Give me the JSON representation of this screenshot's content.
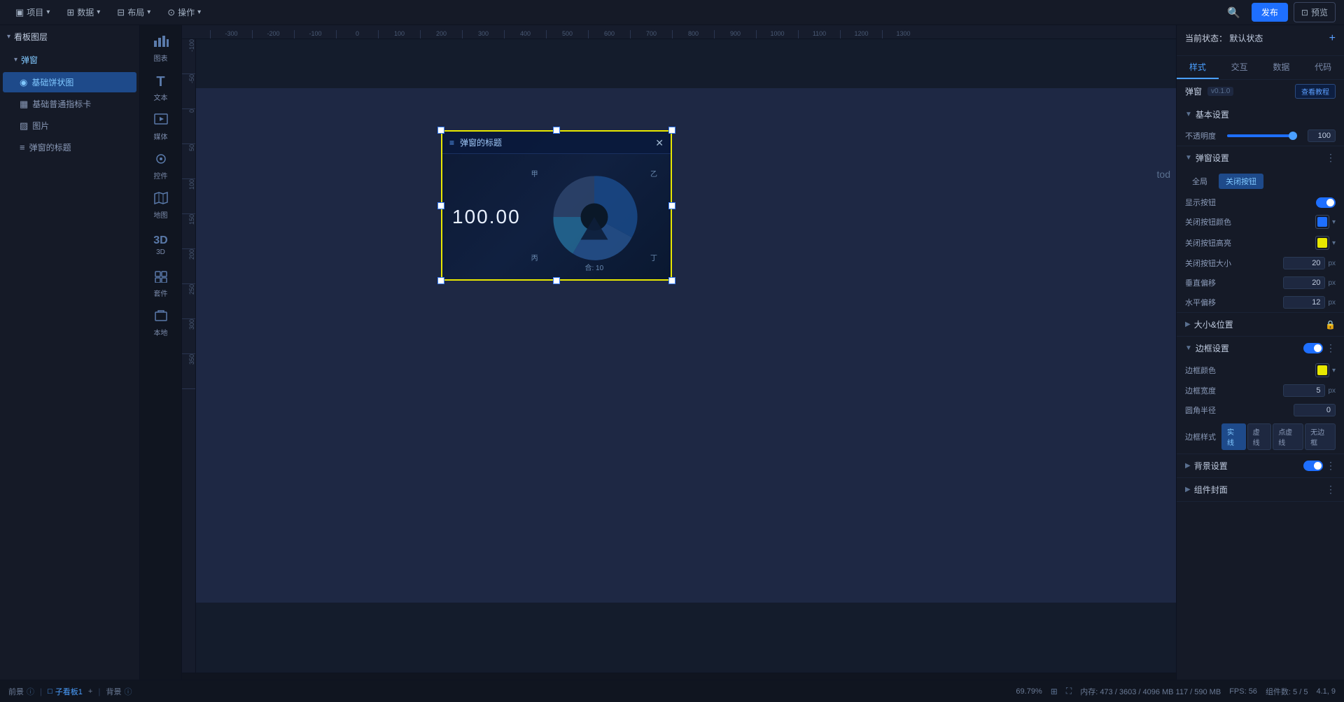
{
  "topbar": {
    "items": [
      {
        "id": "project",
        "icon": "▣",
        "label": "项目",
        "arrow": "▾"
      },
      {
        "id": "data",
        "icon": "⊞",
        "label": "数据",
        "arrow": "▾"
      },
      {
        "id": "layout",
        "icon": "⊟",
        "label": "布局",
        "arrow": "▾"
      },
      {
        "id": "actions",
        "icon": "⊙",
        "label": "操作",
        "arrow": "▾"
      }
    ],
    "publish_label": "发布",
    "preview_label": "预览"
  },
  "left_sidebar": {
    "section_label": "看板图层",
    "section_arrow": "▾",
    "subsection": {
      "label": "弹窗",
      "items": [
        {
          "id": "pie",
          "label": "基础饼状图",
          "icon": "◉"
        },
        {
          "id": "tabs",
          "label": "基础普通指标卡",
          "icon": "▦"
        },
        {
          "id": "image",
          "label": "图片",
          "icon": "▨"
        },
        {
          "id": "popuplabel",
          "label": "弹窗的标题",
          "icon": "≡"
        }
      ]
    }
  },
  "icon_panel": {
    "items": [
      {
        "id": "chart",
        "icon": "📊",
        "label": "图表"
      },
      {
        "id": "text",
        "icon": "T",
        "label": "文本"
      },
      {
        "id": "media",
        "icon": "▣",
        "label": "媒体"
      },
      {
        "id": "control",
        "icon": "⊡",
        "label": "控件"
      },
      {
        "id": "map",
        "icon": "🗺",
        "label": "地图"
      },
      {
        "id": "3d",
        "icon": "◈",
        "label": "3D"
      },
      {
        "id": "component",
        "icon": "⊕",
        "label": "套件"
      },
      {
        "id": "local",
        "icon": "⊞",
        "label": "本地"
      }
    ]
  },
  "ruler": {
    "top_marks": [
      "-300",
      "-200",
      "-100",
      "0",
      "100",
      "200",
      "300",
      "400",
      "500",
      "600",
      "700",
      "800",
      "900",
      "1000",
      "1100",
      "1200",
      "1300"
    ],
    "left_marks": [
      "-100",
      "-50",
      "0",
      "50",
      "100",
      "150",
      "200",
      "250",
      "300",
      "350"
    ]
  },
  "canvas": {
    "popup_title": "弹窗的标题",
    "popup_value": "100.00",
    "pie_labels": {
      "tl": "甲",
      "tr": "乙",
      "bl": "丙",
      "br": "丁",
      "bottom": "合: 10"
    }
  },
  "right_panel": {
    "state_label": "当前状态：",
    "state_value": "默认状态",
    "tabs": [
      "样式",
      "交互",
      "数据",
      "代码"
    ],
    "active_tab": "样式",
    "component_name": "弹窗",
    "component_version": "v0.1.0",
    "see_tutorial": "查看教程",
    "sections": {
      "basic": {
        "label": "基本设置",
        "opacity_label": "不透明度",
        "opacity_value": "100",
        "opacity_fill_pct": 95
      },
      "popup": {
        "label": "弹窗设置",
        "sub_tabs": [
          "全局",
          "关闭按钮"
        ],
        "active_sub_tab": "关闭按钮",
        "show_button_label": "显示按钮",
        "close_btn_color_label": "关闭按钮颜色",
        "close_btn_highlight_label": "关闭按钮高亮",
        "close_btn_size_label": "关闭按钮大小",
        "close_btn_size_value": "20",
        "vertical_offset_label": "垂直偏移",
        "vertical_offset_value": "20",
        "horizontal_offset_label": "水平偏移",
        "horizontal_offset_value": "12",
        "close_btn_color": "#1e6fff",
        "close_btn_highlight_color": "#e8e800"
      },
      "size_pos": {
        "label": "大小&位置"
      },
      "border": {
        "label": "边框设置",
        "color_label": "边框颜色",
        "width_label": "边框宽度",
        "width_value": "5",
        "radius_label": "圆角半径",
        "radius_value": "0",
        "style_label": "边框样式",
        "style_options": [
          "实线",
          "虚线",
          "点虚线",
          "无边框"
        ],
        "active_style": "实线",
        "border_color": "#e8e800"
      },
      "background": {
        "label": "背景设置"
      },
      "cover": {
        "label": "组件封面"
      }
    }
  },
  "bottom_bar": {
    "prev_label": "前景",
    "child_canvas_label": "子看板1",
    "add_label": "+",
    "background_label": "背景",
    "zoom_label": "69.79%",
    "memory_label": "内存: 473 / 3603 / 4096 MB  117 / 590 MB",
    "fps_label": "FPS: 56",
    "component_count": "组件数: 5 / 5",
    "position_label": "4.1, 9"
  },
  "tod": "tod"
}
